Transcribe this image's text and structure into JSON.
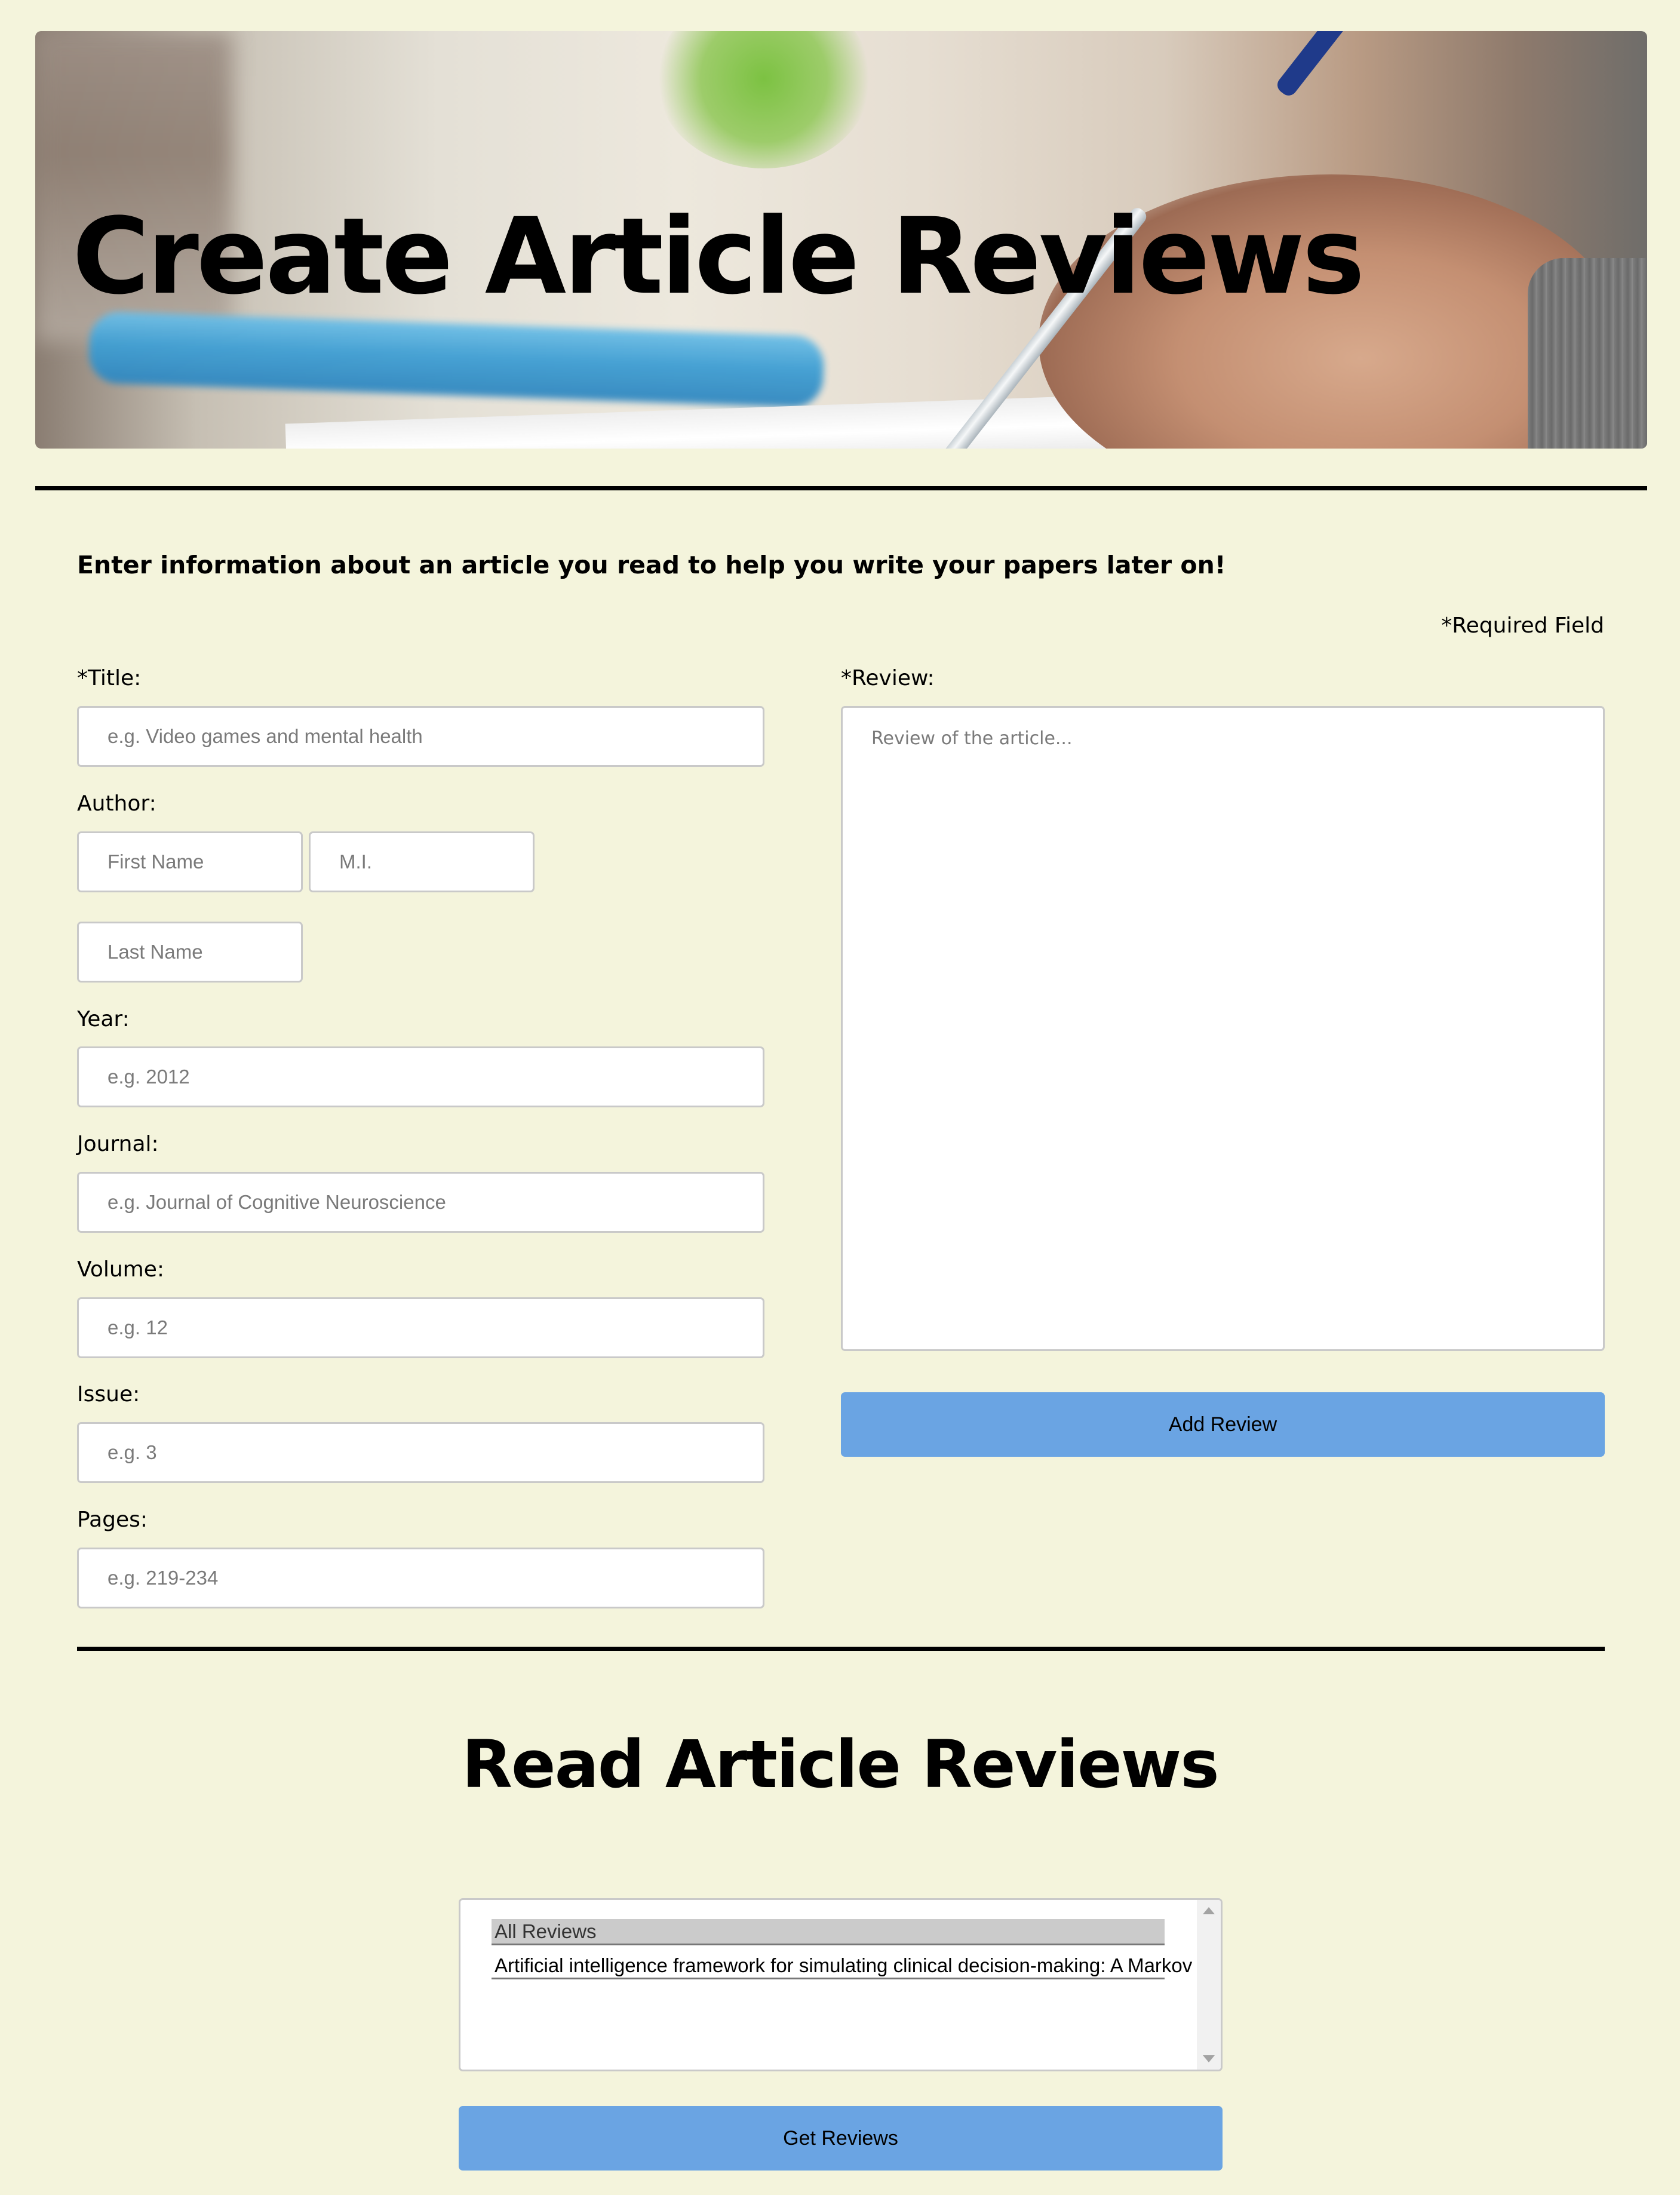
{
  "header": {
    "title": "Create Article Reviews"
  },
  "create_form": {
    "intro": "Enter information about an article you read to help you write your papers later on!",
    "required_note": "*Required Field",
    "title_label": "*Title:",
    "title_placeholder": "e.g. Video games and mental health",
    "author_label": "Author:",
    "first_name_placeholder": "First Name",
    "middle_initial_placeholder": "M.I.",
    "last_name_placeholder": "Last Name",
    "year_label": "Year:",
    "year_placeholder": "e.g. 2012",
    "journal_label": "Journal:",
    "journal_placeholder": "e.g. Journal of Cognitive Neuroscience",
    "volume_label": "Volume:",
    "volume_placeholder": "e.g. 12",
    "issue_label": "Issue:",
    "issue_placeholder": "e.g. 3",
    "pages_label": "Pages:",
    "pages_placeholder": "e.g. 219-234",
    "review_label": "*Review:",
    "review_placeholder": "Review of the article...",
    "add_button": "Add Review"
  },
  "read_section": {
    "heading": "Read Article Reviews",
    "options": [
      "All Reviews",
      "Artificial intelligence framework for simulating clinical decision-making: A Markov"
    ],
    "selected_index": 0,
    "get_button": "Get Reviews"
  },
  "colors": {
    "background": "#f4f4dc",
    "button": "#6aa4e3"
  }
}
